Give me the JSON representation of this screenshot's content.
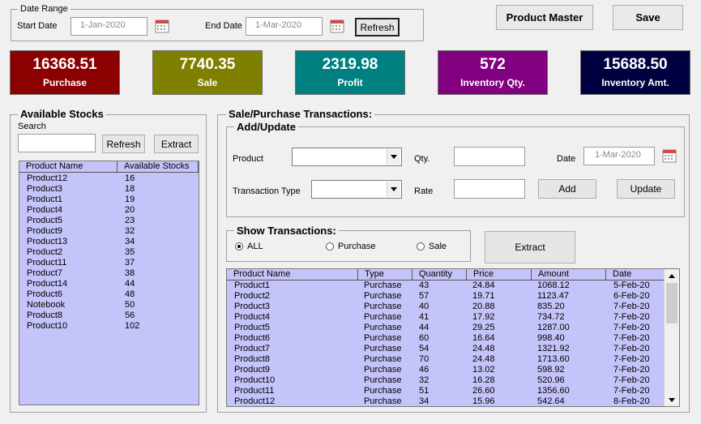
{
  "date_range": {
    "title": "Date Range",
    "start_label": "Start Date",
    "start_value": "1-Jan-2020",
    "end_label": "End Date",
    "end_value": "1-Mar-2020",
    "refresh_label": "Refresh"
  },
  "top_buttons": {
    "product_master": "Product Master",
    "save": "Save"
  },
  "kpis": [
    {
      "value": "16368.51",
      "label": "Purchase",
      "color": "#8b0000"
    },
    {
      "value": "7740.35",
      "label": "Sale",
      "color": "#808000"
    },
    {
      "value": "2319.98",
      "label": "Profit",
      "color": "#008080"
    },
    {
      "value": "572",
      "label": "Inventory Qty.",
      "color": "#800080"
    },
    {
      "value": "15688.50",
      "label": "Inventory Amt.",
      "color": "#000040"
    }
  ],
  "stocks": {
    "title": "Available Stocks",
    "search_label": "Search",
    "search_value": "",
    "refresh_label": "Refresh",
    "extract_label": "Extract",
    "columns": [
      "Product Name",
      "Available Stocks"
    ],
    "rows": [
      [
        "Product12",
        "16"
      ],
      [
        "Product3",
        "18"
      ],
      [
        "Product1",
        "19"
      ],
      [
        "Product4",
        "20"
      ],
      [
        "Product5",
        "23"
      ],
      [
        "Product9",
        "32"
      ],
      [
        "Product13",
        "34"
      ],
      [
        "Product2",
        "35"
      ],
      [
        "Product11",
        "37"
      ],
      [
        "Product7",
        "38"
      ],
      [
        "Product14",
        "44"
      ],
      [
        "Product6",
        "48"
      ],
      [
        "Notebook",
        "50"
      ],
      [
        "Product8",
        "56"
      ],
      [
        "Product10",
        "102"
      ]
    ]
  },
  "transactions": {
    "title": "Sale/Purchase Transactions:",
    "add_update": {
      "title": "Add/Update",
      "product_label": "Product",
      "product_value": "",
      "qty_label": "Qty.",
      "qty_value": "",
      "date_label": "Date",
      "date_value": "1-Mar-2020",
      "type_label": "Transaction Type",
      "type_value": "",
      "rate_label": "Rate",
      "rate_value": "",
      "add_label": "Add",
      "update_label": "Update"
    },
    "show": {
      "title": "Show Transactions:",
      "options": [
        "ALL",
        "Purchase",
        "Sale"
      ],
      "selected": "ALL",
      "extract_label": "Extract"
    },
    "columns": [
      "Product Name",
      "Type",
      "Quantity",
      "Price",
      "Amount",
      "Date"
    ],
    "rows": [
      [
        "Product1",
        "Purchase",
        "43",
        "24.84",
        "1068.12",
        "5-Feb-20"
      ],
      [
        "Product2",
        "Purchase",
        "57",
        "19.71",
        "1123.47",
        "6-Feb-20"
      ],
      [
        "Product3",
        "Purchase",
        "40",
        "20.88",
        "835.20",
        "7-Feb-20"
      ],
      [
        "Product4",
        "Purchase",
        "41",
        "17.92",
        "734.72",
        "7-Feb-20"
      ],
      [
        "Product5",
        "Purchase",
        "44",
        "29.25",
        "1287.00",
        "7-Feb-20"
      ],
      [
        "Product6",
        "Purchase",
        "60",
        "16.64",
        "998.40",
        "7-Feb-20"
      ],
      [
        "Product7",
        "Purchase",
        "54",
        "24.48",
        "1321.92",
        "7-Feb-20"
      ],
      [
        "Product8",
        "Purchase",
        "70",
        "24.48",
        "1713.60",
        "7-Feb-20"
      ],
      [
        "Product9",
        "Purchase",
        "46",
        "13.02",
        "598.92",
        "7-Feb-20"
      ],
      [
        "Product10",
        "Purchase",
        "32",
        "16.28",
        "520.96",
        "7-Feb-20"
      ],
      [
        "Product11",
        "Purchase",
        "51",
        "26.60",
        "1356.60",
        "7-Feb-20"
      ],
      [
        "Product12",
        "Purchase",
        "34",
        "15.96",
        "542.64",
        "8-Feb-20"
      ]
    ]
  }
}
